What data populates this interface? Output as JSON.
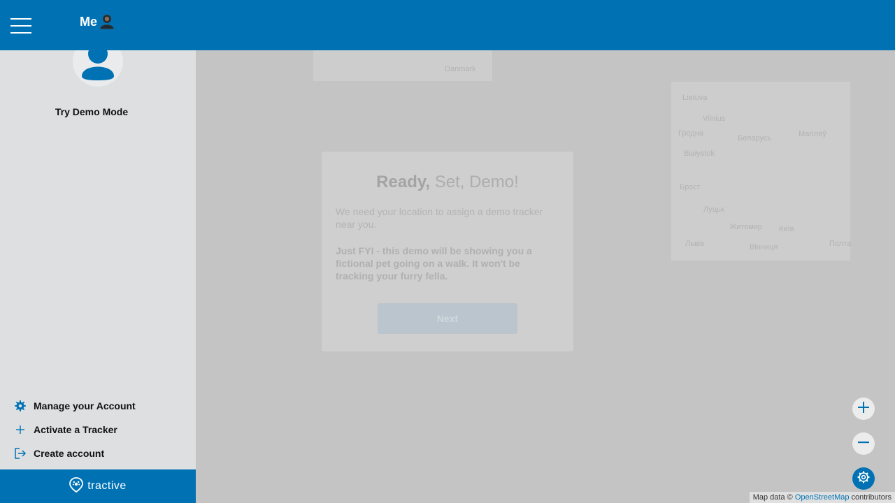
{
  "header": {
    "title": "Me",
    "menu_icon": "hamburger-icon",
    "title_icon": "person-icon"
  },
  "sidebar": {
    "avatar_icon": "user-avatar-icon",
    "demo_label": "Try Demo Mode",
    "items": [
      {
        "label": "Manage your Account",
        "icon": "gear-icon"
      },
      {
        "label": "Activate a Tracker",
        "icon": "plus-icon"
      },
      {
        "label": "Create account",
        "icon": "sign-in-icon"
      }
    ],
    "brand": "tractive",
    "brand_icon": "tractive-logo-icon"
  },
  "demo": {
    "title_bold": "Ready,",
    "title_rest": " Set, Demo!",
    "description": "We need your location to assign a demo tracker near you.",
    "fyi": "Just FYI - this demo will be showing you a fictional pet going on a walk. It won't be tracking your furry fella.",
    "next_label": "Next"
  },
  "map": {
    "labels": [
      "Danmark",
      "Lietuva",
      "Vilnius",
      "Гродна",
      "Беларусь",
      "Магілёў",
      "Białystok",
      "Брэст",
      "Луцьк",
      "Житомир",
      "Київ",
      "Львів",
      "Вінниця",
      "Полта"
    ],
    "controls": {
      "zoom_in_icon": "plus-icon",
      "zoom_out_icon": "minus-icon",
      "settings_icon": "map-settings-icon"
    },
    "attribution_prefix": "Map data © ",
    "attribution_link": "OpenStreetMap",
    "attribution_suffix": " contributors"
  },
  "colors": {
    "brand": "#0072b4",
    "sidebar_bg": "#dedfe1",
    "overlay": "#c4c4c4"
  }
}
